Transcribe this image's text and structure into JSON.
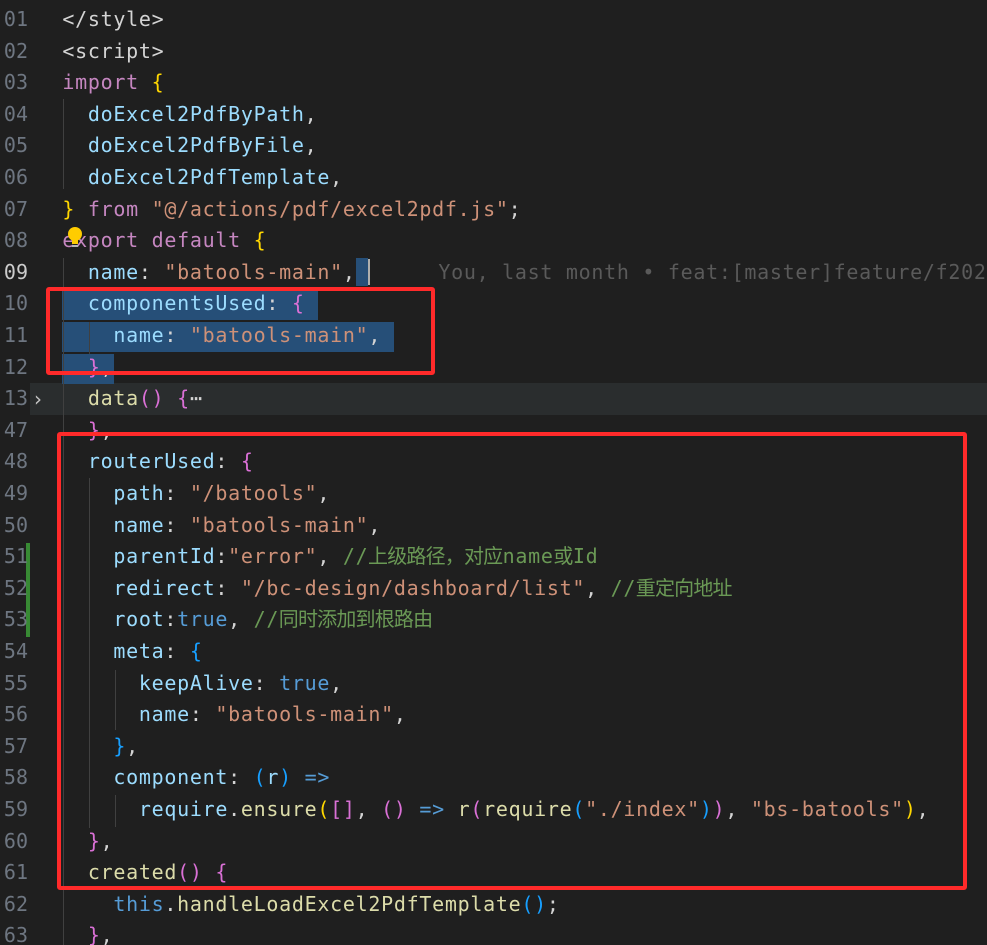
{
  "editor": {
    "colors": {
      "background": "#1f1f1f",
      "selection": "#264f78",
      "annotation_box": "#ff2a2a",
      "git_modified": "#388a34"
    },
    "git_blame": "You, last month • feat:[master]feature/f202",
    "lines": [
      {
        "num": "01",
        "tokens": [
          [
            "</",
            "pu"
          ],
          [
            "style",
            "pu"
          ],
          [
            ">",
            "pu"
          ]
        ]
      },
      {
        "num": "02",
        "tokens": [
          [
            "<",
            "pu"
          ],
          [
            "script",
            "pu"
          ],
          [
            ">",
            "pu"
          ]
        ]
      },
      {
        "num": "03",
        "tokens": [
          [
            "import",
            "kw"
          ],
          [
            " ",
            "pu"
          ],
          [
            "{",
            "b1"
          ]
        ]
      },
      {
        "num": "04",
        "tokens": [
          [
            "  ",
            "pu"
          ],
          [
            "doExcel2PdfByPath",
            "prop"
          ],
          [
            ",",
            "pu"
          ]
        ]
      },
      {
        "num": "05",
        "tokens": [
          [
            "  ",
            "pu"
          ],
          [
            "doExcel2PdfByFile",
            "prop"
          ],
          [
            ",",
            "pu"
          ]
        ]
      },
      {
        "num": "06",
        "tokens": [
          [
            "  ",
            "pu"
          ],
          [
            "doExcel2PdfTemplate",
            "prop"
          ],
          [
            ",",
            "pu"
          ]
        ]
      },
      {
        "num": "07",
        "tokens": [
          [
            "}",
            "b1"
          ],
          [
            " ",
            "pu"
          ],
          [
            "from",
            "kw"
          ],
          [
            " ",
            "pu"
          ],
          [
            "\"@/actions/pdf/excel2pdf.js\"",
            "str"
          ],
          [
            ";",
            "pu"
          ]
        ]
      },
      {
        "num": "08",
        "tokens": [
          [
            "export",
            "kw"
          ],
          [
            " ",
            "pu"
          ],
          [
            "default",
            "kw"
          ],
          [
            " ",
            "pu"
          ],
          [
            "{",
            "b1"
          ]
        ]
      },
      {
        "num": "09",
        "tokens": [
          [
            "  ",
            "pu"
          ],
          [
            "name",
            "prop"
          ],
          [
            ": ",
            "pu"
          ],
          [
            "\"batools-main\"",
            "str"
          ],
          [
            ",",
            "pu"
          ]
        ]
      },
      {
        "num": "10",
        "tokens": [
          [
            "  ",
            "pu"
          ],
          [
            "componentsUsed",
            "prop"
          ],
          [
            ": ",
            "pu"
          ],
          [
            "{",
            "b2"
          ]
        ]
      },
      {
        "num": "11",
        "tokens": [
          [
            "    ",
            "pu"
          ],
          [
            "name",
            "prop"
          ],
          [
            ": ",
            "pu"
          ],
          [
            "\"batools-main\"",
            "str"
          ],
          [
            ",",
            "pu"
          ]
        ]
      },
      {
        "num": "12",
        "tokens": [
          [
            "  ",
            "pu"
          ],
          [
            "}",
            "b2"
          ],
          [
            ",",
            "pu"
          ]
        ]
      },
      {
        "num": "13",
        "tokens": [
          [
            "  ",
            "pu"
          ],
          [
            "data",
            "fn"
          ],
          [
            "()",
            "b2"
          ],
          [
            " ",
            "pu"
          ],
          [
            "{",
            "b2"
          ],
          [
            "⋯",
            "pu"
          ]
        ]
      },
      {
        "num": "47",
        "tokens": [
          [
            "  ",
            "pu"
          ],
          [
            "}",
            "b2"
          ],
          [
            ",",
            "pu"
          ]
        ]
      },
      {
        "num": "48",
        "tokens": [
          [
            "  ",
            "pu"
          ],
          [
            "routerUsed",
            "prop"
          ],
          [
            ": ",
            "pu"
          ],
          [
            "{",
            "b2"
          ]
        ]
      },
      {
        "num": "49",
        "tokens": [
          [
            "    ",
            "pu"
          ],
          [
            "path",
            "prop"
          ],
          [
            ": ",
            "pu"
          ],
          [
            "\"/batools\"",
            "str"
          ],
          [
            ",",
            "pu"
          ]
        ]
      },
      {
        "num": "50",
        "tokens": [
          [
            "    ",
            "pu"
          ],
          [
            "name",
            "prop"
          ],
          [
            ": ",
            "pu"
          ],
          [
            "\"batools-main\"",
            "str"
          ],
          [
            ",",
            "pu"
          ]
        ]
      },
      {
        "num": "51",
        "tokens": [
          [
            "    ",
            "pu"
          ],
          [
            "parentId",
            "prop"
          ],
          [
            ":",
            "pu"
          ],
          [
            "\"error\"",
            "str"
          ],
          [
            ", ",
            "pu"
          ],
          [
            "//上级路径，对应name或Id",
            "cm"
          ]
        ]
      },
      {
        "num": "52",
        "tokens": [
          [
            "    ",
            "pu"
          ],
          [
            "redirect",
            "prop"
          ],
          [
            ": ",
            "pu"
          ],
          [
            "\"/bc-design/dashboard/list\"",
            "str"
          ],
          [
            ", ",
            "pu"
          ],
          [
            "//重定向地址",
            "cm"
          ]
        ]
      },
      {
        "num": "53",
        "tokens": [
          [
            "    ",
            "pu"
          ],
          [
            "root",
            "prop"
          ],
          [
            ":",
            "pu"
          ],
          [
            "true",
            "con"
          ],
          [
            ", ",
            "pu"
          ],
          [
            "//同时添加到根路由",
            "cm"
          ]
        ]
      },
      {
        "num": "54",
        "tokens": [
          [
            "    ",
            "pu"
          ],
          [
            "meta",
            "prop"
          ],
          [
            ": ",
            "pu"
          ],
          [
            "{",
            "b3"
          ]
        ]
      },
      {
        "num": "55",
        "tokens": [
          [
            "      ",
            "pu"
          ],
          [
            "keepAlive",
            "prop"
          ],
          [
            ": ",
            "pu"
          ],
          [
            "true",
            "con"
          ],
          [
            ",",
            "pu"
          ]
        ]
      },
      {
        "num": "56",
        "tokens": [
          [
            "      ",
            "pu"
          ],
          [
            "name",
            "prop"
          ],
          [
            ": ",
            "pu"
          ],
          [
            "\"batools-main\"",
            "str"
          ],
          [
            ",",
            "pu"
          ]
        ]
      },
      {
        "num": "57",
        "tokens": [
          [
            "    ",
            "pu"
          ],
          [
            "}",
            "b3"
          ],
          [
            ",",
            "pu"
          ]
        ]
      },
      {
        "num": "58",
        "tokens": [
          [
            "    ",
            "pu"
          ],
          [
            "component",
            "prop"
          ],
          [
            ": ",
            "pu"
          ],
          [
            "(",
            "b3"
          ],
          [
            "r",
            "prop"
          ],
          [
            ")",
            "b3"
          ],
          [
            " ",
            "pu"
          ],
          [
            "=>",
            "con"
          ]
        ]
      },
      {
        "num": "59",
        "tokens": [
          [
            "      ",
            "pu"
          ],
          [
            "require",
            "prop"
          ],
          [
            ".",
            "pu"
          ],
          [
            "ensure",
            "fn"
          ],
          [
            "(",
            "b1"
          ],
          [
            "[]",
            "b2"
          ],
          [
            ", ",
            "pu"
          ],
          [
            "()",
            "b2"
          ],
          [
            " ",
            "pu"
          ],
          [
            "=>",
            "con"
          ],
          [
            " ",
            "pu"
          ],
          [
            "r",
            "fn"
          ],
          [
            "(",
            "b2"
          ],
          [
            "require",
            "fn"
          ],
          [
            "(",
            "b3"
          ],
          [
            "\"./index\"",
            "str"
          ],
          [
            ")",
            "b3"
          ],
          [
            ")",
            "b2"
          ],
          [
            ", ",
            "pu"
          ],
          [
            "\"bs-batools\"",
            "str"
          ],
          [
            ")",
            "b1"
          ],
          [
            ",",
            "pu"
          ]
        ]
      },
      {
        "num": "60",
        "tokens": [
          [
            "  ",
            "pu"
          ],
          [
            "}",
            "b2"
          ],
          [
            ",",
            "pu"
          ]
        ]
      },
      {
        "num": "61",
        "tokens": [
          [
            "  ",
            "pu"
          ],
          [
            "created",
            "fn"
          ],
          [
            "()",
            "b2"
          ],
          [
            " ",
            "pu"
          ],
          [
            "{",
            "b2"
          ]
        ]
      },
      {
        "num": "62",
        "tokens": [
          [
            "    ",
            "pu"
          ],
          [
            "this",
            "con"
          ],
          [
            ".",
            "pu"
          ],
          [
            "handleLoadExcel2PdfTemplate",
            "fn"
          ],
          [
            "()",
            "b3"
          ],
          [
            ";",
            "pu"
          ]
        ]
      },
      {
        "num": "63",
        "tokens": [
          [
            "  ",
            "pu"
          ],
          [
            "}",
            "b2"
          ],
          [
            ",",
            "pu"
          ]
        ]
      }
    ]
  }
}
